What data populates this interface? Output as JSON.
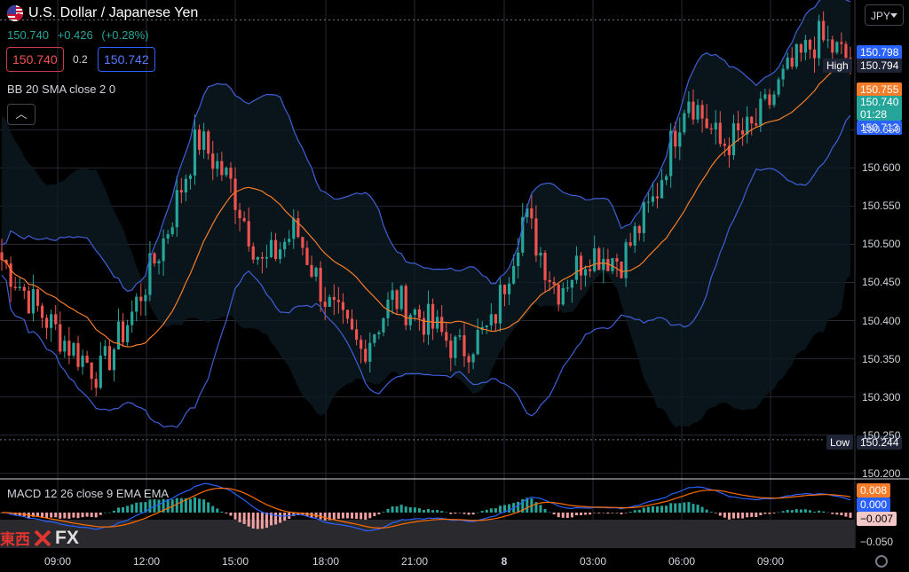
{
  "header": {
    "title": "U.S. Dollar / Japanese Yen",
    "price": "150.740",
    "change": "+0.426",
    "change_pct": "(+0.28%)",
    "bid": "150.740",
    "spread": "0.2",
    "ask": "150.742",
    "currency": "JPY"
  },
  "indicators": {
    "bb_label": "BB 20 SMA close 2 0",
    "macd_label": "MACD 12 26 close 9 EMA EMA"
  },
  "colors": {
    "up": "#26a69a",
    "down": "#ef5350",
    "bb": "#3f5fd8",
    "basis": "#f57c28",
    "macd": "#2962ff",
    "signal": "#ff6d00"
  },
  "watermark": {
    "cn": "東西",
    "fx": "FX"
  },
  "price_tags": [
    {
      "text": "150.798",
      "bg": "#2962ff",
      "value": 150.798
    },
    {
      "text": "150.794",
      "bg": "#1e2435",
      "value": 150.794,
      "side": "High"
    },
    {
      "text": "150.755",
      "bg": "#f57c28",
      "value": 150.755
    },
    {
      "text": "150.740",
      "bg": "#26a69a",
      "value": 150.74,
      "sub": "01:28"
    },
    {
      "text": "150.713",
      "bg": "#2962ff",
      "value": 150.713
    },
    {
      "text": "150.244",
      "bg": "#1e2435",
      "value": 150.244,
      "side": "Low"
    }
  ],
  "macd_tags": [
    {
      "text": "0.008",
      "bg": "#f57c28"
    },
    {
      "text": "0.000",
      "bg": "#2962ff"
    },
    {
      "text": "−0.007",
      "bg": "#f4c7c7",
      "fg": "#000"
    },
    {
      "text": "−0.050",
      "bg": "",
      "fg": "#d1d4dc"
    }
  ],
  "chart_data": {
    "type": "line",
    "title": "U.S. Dollar / Japanese Yen",
    "ylim": [
      150.195,
      150.82
    ],
    "y_ticks": [
      "150.650",
      "150.600",
      "150.550",
      "150.500",
      "150.450",
      "150.400",
      "150.350",
      "150.300",
      "150.250",
      "150.200"
    ],
    "x_ticks": [
      "09:00",
      "12:00",
      "15:00",
      "18:00",
      "21:00",
      "8",
      "03:00",
      "06:00",
      "09:00"
    ],
    "series": [
      {
        "name": "close",
        "x": [
          "09:00",
          "10:00",
          "11:00",
          "12:00",
          "13:00",
          "14:00",
          "15:00",
          "16:00",
          "17:00",
          "18:00",
          "19:00",
          "20:00",
          "21:00",
          "22:00",
          "23:00",
          "8",
          "01:00",
          "02:00",
          "03:00",
          "04:00",
          "05:00",
          "06:00",
          "07:00",
          "08:00",
          "09:00",
          "10:00",
          "10:30"
        ],
        "values": [
          150.48,
          150.42,
          150.37,
          150.33,
          150.41,
          150.51,
          150.64,
          150.58,
          150.47,
          150.52,
          150.42,
          150.36,
          150.43,
          150.4,
          150.36,
          150.39,
          150.54,
          150.44,
          150.49,
          150.48,
          150.56,
          150.7,
          150.63,
          150.65,
          150.72,
          150.77,
          150.74
        ]
      }
    ],
    "high": 150.794,
    "low": 150.244,
    "last": 150.74
  }
}
